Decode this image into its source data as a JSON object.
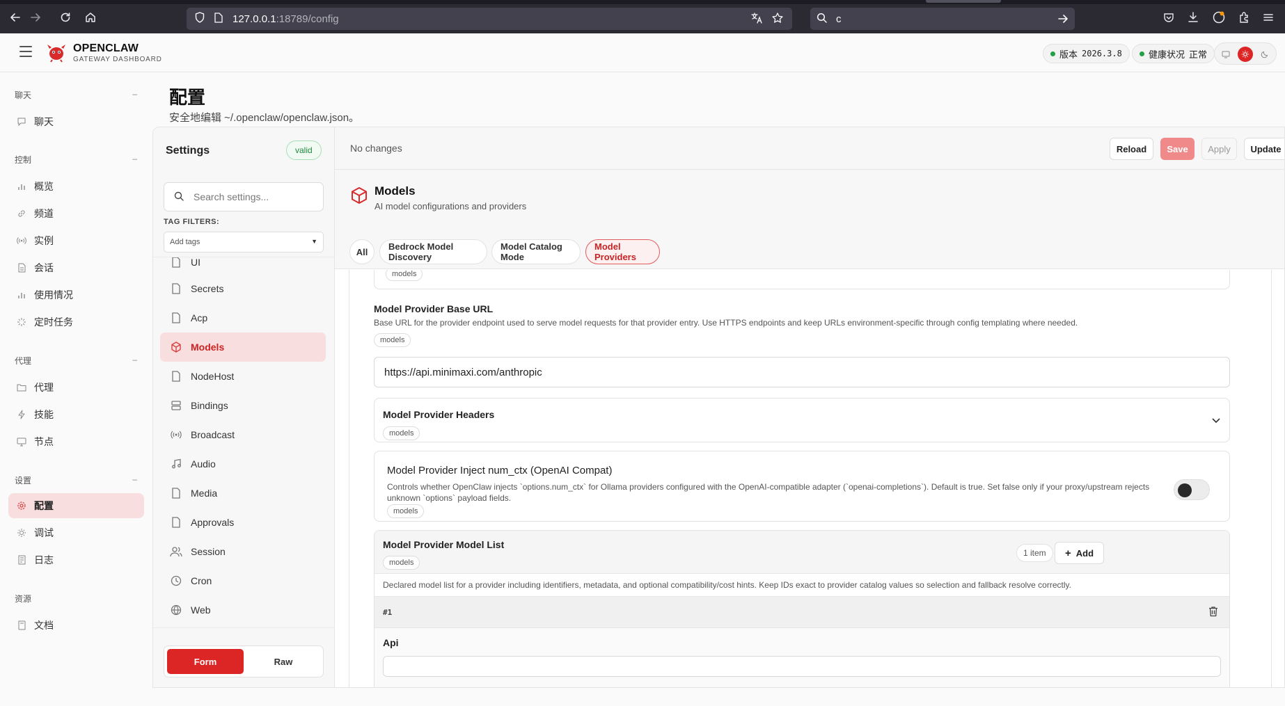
{
  "browser": {
    "url_host": "127.0.0.1",
    "url_path": ":18789/config",
    "search_value": "c"
  },
  "header": {
    "brand_title": "OPENCLAW",
    "brand_sub": "GATEWAY DASHBOARD",
    "version_label": "版本",
    "version_value": "2026.3.8",
    "health_label": "健康状况",
    "health_value": "正常",
    "accent_color": "#dc2626"
  },
  "leftnav": {
    "groups": [
      {
        "label": "聊天",
        "items": [
          {
            "label": "聊天",
            "icon": "chat-bubble-icon"
          }
        ]
      },
      {
        "label": "控制",
        "items": [
          {
            "label": "概览",
            "icon": "bar-chart-icon"
          },
          {
            "label": "频道",
            "icon": "link-icon"
          },
          {
            "label": "实例",
            "icon": "broadcast-icon"
          },
          {
            "label": "会话",
            "icon": "document-icon"
          },
          {
            "label": "使用情况",
            "icon": "bar-chart-icon"
          },
          {
            "label": "定时任务",
            "icon": "spinner-icon"
          }
        ]
      },
      {
        "label": "代理",
        "items": [
          {
            "label": "代理",
            "icon": "folder-icon"
          },
          {
            "label": "技能",
            "icon": "bolt-icon"
          },
          {
            "label": "节点",
            "icon": "monitor-icon"
          }
        ]
      },
      {
        "label": "设置",
        "items": [
          {
            "label": "配置",
            "icon": "gear-icon"
          },
          {
            "label": "调试",
            "icon": "bug-icon"
          },
          {
            "label": "日志",
            "icon": "log-icon"
          }
        ]
      },
      {
        "label": "资源",
        "items": [
          {
            "label": "文档",
            "icon": "book-icon"
          }
        ]
      }
    ]
  },
  "page": {
    "title": "配置",
    "subtitle": "安全地编辑 ~/.openclaw/openclaw.json。"
  },
  "settings": {
    "title": "Settings",
    "valid_badge": "valid",
    "search_placeholder": "Search settings...",
    "tag_filters_label": "TAG FILTERS:",
    "tag_select_value": "Add tags",
    "sections": [
      {
        "label": "UI",
        "icon": "document-icon"
      },
      {
        "label": "Secrets",
        "icon": "document-icon"
      },
      {
        "label": "Acp",
        "icon": "document-icon"
      },
      {
        "label": "Models",
        "icon": "cube-icon"
      },
      {
        "label": "NodeHost",
        "icon": "document-icon"
      },
      {
        "label": "Bindings",
        "icon": "bindings-icon"
      },
      {
        "label": "Broadcast",
        "icon": "broadcast-icon"
      },
      {
        "label": "Audio",
        "icon": "music-note-icon"
      },
      {
        "label": "Media",
        "icon": "document-icon"
      },
      {
        "label": "Approvals",
        "icon": "document-icon"
      },
      {
        "label": "Session",
        "icon": "users-icon"
      },
      {
        "label": "Cron",
        "icon": "clock-icon"
      },
      {
        "label": "Web",
        "icon": "globe-icon"
      }
    ],
    "mode_form": "Form",
    "mode_raw": "Raw"
  },
  "toolbar": {
    "status": "No changes",
    "reload": "Reload",
    "save": "Save",
    "apply": "Apply",
    "update": "Update"
  },
  "section": {
    "title": "Models",
    "subtitle": "AI model configurations and providers",
    "chips": [
      "All",
      "Bedrock Model Discovery",
      "Model Catalog Mode",
      "Model Providers"
    ],
    "active_chip": "Model Providers"
  },
  "fields": {
    "tag": "models",
    "base_url": {
      "label": "Model Provider Base URL",
      "desc": "Base URL for the provider endpoint used to serve model requests for that provider entry. Use HTTPS endpoints and keep URLs environment-specific through config templating where needed.",
      "value": "https://api.minimaxi.com/anthropic"
    },
    "headers": {
      "label": "Model Provider Headers"
    },
    "inject": {
      "label": "Model Provider Inject num_ctx (OpenAI Compat)",
      "desc1": "Controls whether OpenClaw injects `options.num_ctx` for Ollama providers configured with the OpenAI-compatible adapter (`openai-completions`). Default is true. Set false only if your proxy/upstream rejects",
      "desc2": "unknown `options` payload fields."
    },
    "model_list": {
      "label": "Model Provider Model List",
      "count": "1 item",
      "add": "Add",
      "desc": "Declared model list for a provider including identifiers, metadata, and optional compatibility/cost hints. Keep IDs exact to provider catalog values so selection and fallback resolve correctly.",
      "item_index": "#1",
      "api_label": "Api"
    }
  }
}
